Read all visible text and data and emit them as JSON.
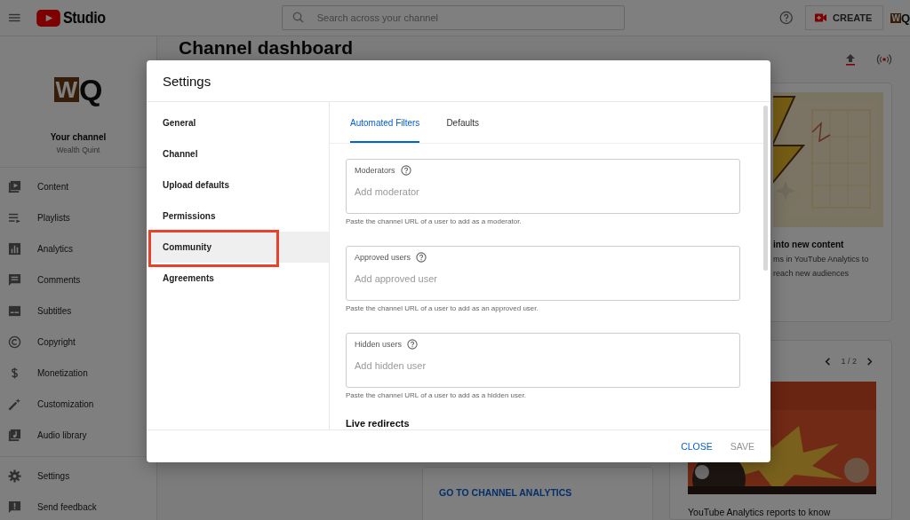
{
  "topbar": {
    "brand": "Studio",
    "search": {
      "placeholder": "Search across your channel"
    },
    "create_button": "CREATE",
    "avatar": {
      "first": "W",
      "second": "Q"
    }
  },
  "sidebar": {
    "logo": {
      "first": "W",
      "second": "Q"
    },
    "channel_title": "Your channel",
    "channel_name": "Wealth Quint",
    "items": [
      {
        "label": "Content"
      },
      {
        "label": "Playlists"
      },
      {
        "label": "Analytics"
      },
      {
        "label": "Comments"
      },
      {
        "label": "Subtitles"
      },
      {
        "label": "Copyright"
      },
      {
        "label": "Monetization"
      },
      {
        "label": "Customization"
      },
      {
        "label": "Audio library"
      }
    ],
    "footer_items": [
      {
        "label": "Settings"
      },
      {
        "label": "Send feedback"
      }
    ]
  },
  "dashboard": {
    "title": "Channel dashboard",
    "analytics_link": "GO TO CHANNEL ANALYTICS",
    "idea_card": {
      "title": "into new content",
      "lines": [
        "ms in YouTube Analytics to",
        "reach new audiences"
      ]
    },
    "video_card": {
      "pager": "1 / 2",
      "title": "YouTube Analytics reports to know"
    }
  },
  "dialog": {
    "title": "Settings",
    "nav": [
      {
        "label": "General",
        "selected": false
      },
      {
        "label": "Channel",
        "selected": false
      },
      {
        "label": "Upload defaults",
        "selected": false
      },
      {
        "label": "Permissions",
        "selected": false
      },
      {
        "label": "Community",
        "selected": true
      },
      {
        "label": "Agreements",
        "selected": false
      }
    ],
    "tabs": [
      {
        "label": "Automated Filters",
        "selected": true
      },
      {
        "label": "Defaults",
        "selected": false
      }
    ],
    "fields": [
      {
        "label": "Moderators",
        "placeholder": "Add moderator",
        "hint": "Paste the channel URL of a user to add as a moderator."
      },
      {
        "label": "Approved users",
        "placeholder": "Add approved user",
        "hint": "Paste the channel URL of a user to add as an approved user."
      },
      {
        "label": "Hidden users",
        "placeholder": "Add hidden user",
        "hint": "Paste the channel URL of a user to add as a hidden user."
      }
    ],
    "section_heading": "Live redirects",
    "buttons": [
      {
        "label": "CLOSE",
        "disabled": false
      },
      {
        "label": "SAVE",
        "disabled": true
      }
    ]
  }
}
